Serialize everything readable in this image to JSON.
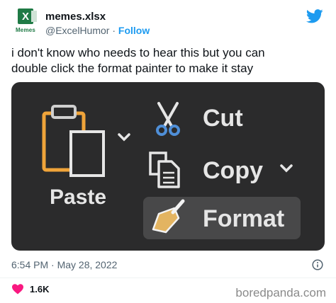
{
  "tweet": {
    "avatar_caption": "Memes",
    "display_name": "memes.xlsx",
    "handle": "@ExcelHumor",
    "separator": " · ",
    "follow_label": "Follow",
    "text": "i don't know who needs to hear this but you can\ndouble click the format painter to make it stay",
    "time": "6:54 PM · May 28, 2022",
    "likes": "1.6K"
  },
  "ribbon": {
    "paste_label": "Paste",
    "cut_label": "Cut",
    "copy_label": "Copy",
    "format_label": "Format"
  },
  "watermark": "boredpanda.com",
  "colors": {
    "twitter_blue": "#1d9bf0",
    "heart": "#f91880",
    "excel_green": "#1f7a45",
    "ribbon_bg": "#2b2b2c"
  }
}
